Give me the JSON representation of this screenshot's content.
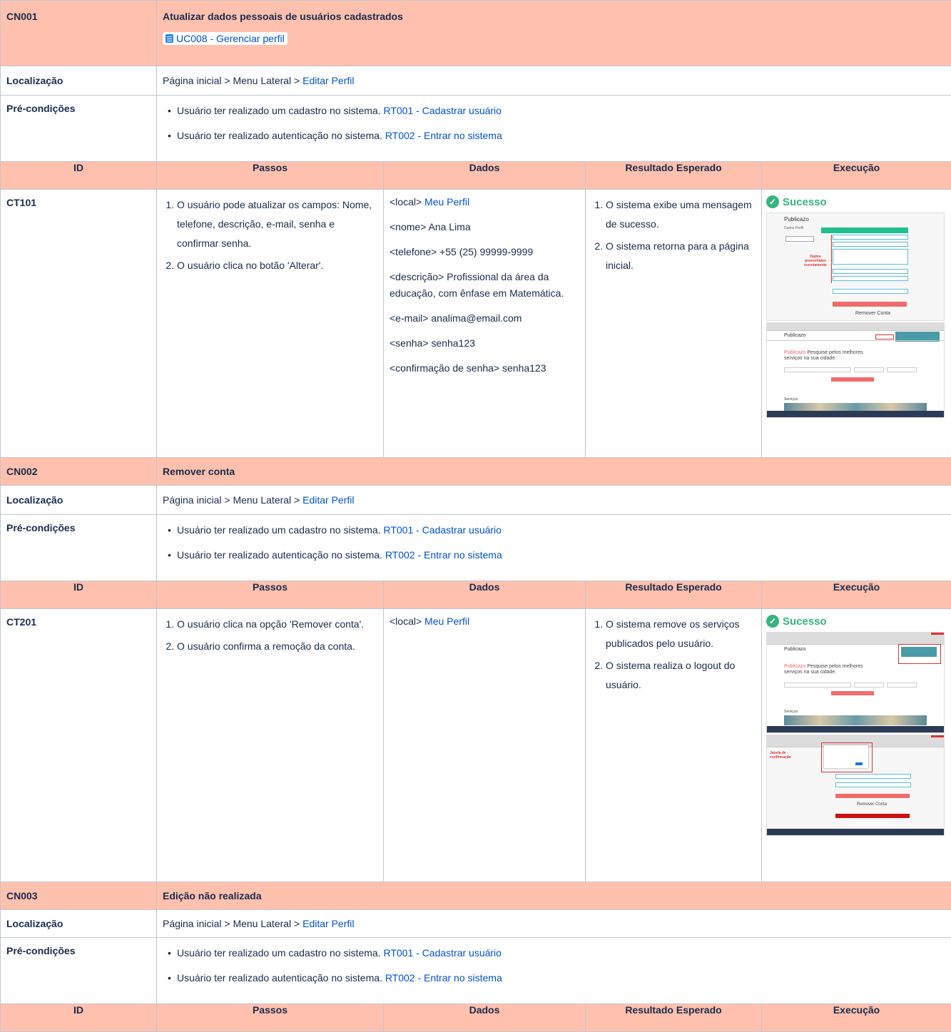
{
  "cases": [
    {
      "code": "CN001",
      "title": "Atualizar dados pessoais de usuários cadastrados",
      "usecase_link": "UC008 - Gerenciar perfil",
      "location_label": "Localização",
      "location_path": "Página inicial > Menu Lateral > ",
      "location_link": "Editar Perfil",
      "pre_label": "Pré-condições",
      "pre": [
        {
          "text": "Usuário ter realizado um cadastro no sistema. ",
          "link": "RT001 - Cadastrar usuário"
        },
        {
          "text": "Usuário ter realizado autenticação no sistema. ",
          "link": "RT002 - Entrar no sistema"
        }
      ],
      "test": {
        "id": "CT101",
        "steps": [
          "O usuário pode atualizar os campos: Nome, telefone, descrição, e-mail, senha e confirmar senha.",
          "O usuário clica no botão 'Alterar'."
        ],
        "data_first_prefix": "<local> ",
        "data_first_link": "Meu Perfil",
        "data": [
          "<nome> Ana Lima",
          "<telefone> +55 (25) 99999-9999",
          "<descrição> Profissional da área da educação, com ênfase em Matemática.",
          "<e-mail> analima@email.com",
          "<senha> senha123",
          "<confirmação de senha> senha123"
        ],
        "expected": [
          "O sistema exibe uma mensagem de sucesso.",
          "O sistema retorna para a página inicial."
        ],
        "status": "Sucesso",
        "shot1": {
          "brand": "Publicazo",
          "side": "Dados Perfil",
          "annot": "Dados preenchidos corretamente",
          "remove": "Remover Conta"
        },
        "shot2": {
          "brand": "Publicazo",
          "headline_brand": "Publicazo",
          "headline": "Pesquise pelos melhores serviços na sua cidade.",
          "section": "Serviços"
        }
      }
    },
    {
      "code": "CN002",
      "title": "Remover conta",
      "location_label": "Localização",
      "location_path": "Página inicial > Menu Lateral > ",
      "location_link": "Editar Perfil",
      "pre_label": "Pré-condições",
      "pre": [
        {
          "text": "Usuário ter realizado um cadastro no sistema. ",
          "link": "RT001 - Cadastrar usuário"
        },
        {
          "text": "Usuário ter realizado autenticação no sistema. ",
          "link": "RT002 - Entrar no sistema"
        }
      ],
      "test": {
        "id": "CT201",
        "steps": [
          "O usuário clica na opção 'Remover conta'.",
          "O usuário confirma a remoção da conta."
        ],
        "data_first_prefix": "<local> ",
        "data_first_link": "Meu Perfil",
        "expected": [
          "O sistema remove os serviços publicados pelo usuário.",
          "O sistema realiza o logout do usuário."
        ],
        "status": "Sucesso",
        "shot1": {
          "brand": "Publicazo",
          "headline_brand": "Publicazo",
          "headline": "Pesquise pelos melhores serviços na sua cidade.",
          "section": "Serviços"
        },
        "shot2": {
          "annot": "Janela de confirmação",
          "remove": "Remover Conta"
        }
      }
    },
    {
      "code": "CN003",
      "title": "Edição não realizada",
      "location_label": "Localização",
      "location_path": "Página inicial > Menu Lateral > ",
      "location_link": "Editar Perfil",
      "pre_label": "Pré-condições",
      "pre": [
        {
          "text": "Usuário ter realizado um cadastro no sistema. ",
          "link": "RT001 - Cadastrar usuário"
        },
        {
          "text": "Usuário ter realizado autenticação no sistema. ",
          "link": "RT002 - Entrar no sistema"
        }
      ]
    }
  ],
  "columns": {
    "id": "ID",
    "steps": "Passos",
    "data": "Dados",
    "expected": "Resultado Esperado",
    "exec": "Execução"
  },
  "colors": {
    "header_bg": "#ffc0ad",
    "link": "#0052cc",
    "success": "#36b37e",
    "border": "#c1c7d0"
  }
}
